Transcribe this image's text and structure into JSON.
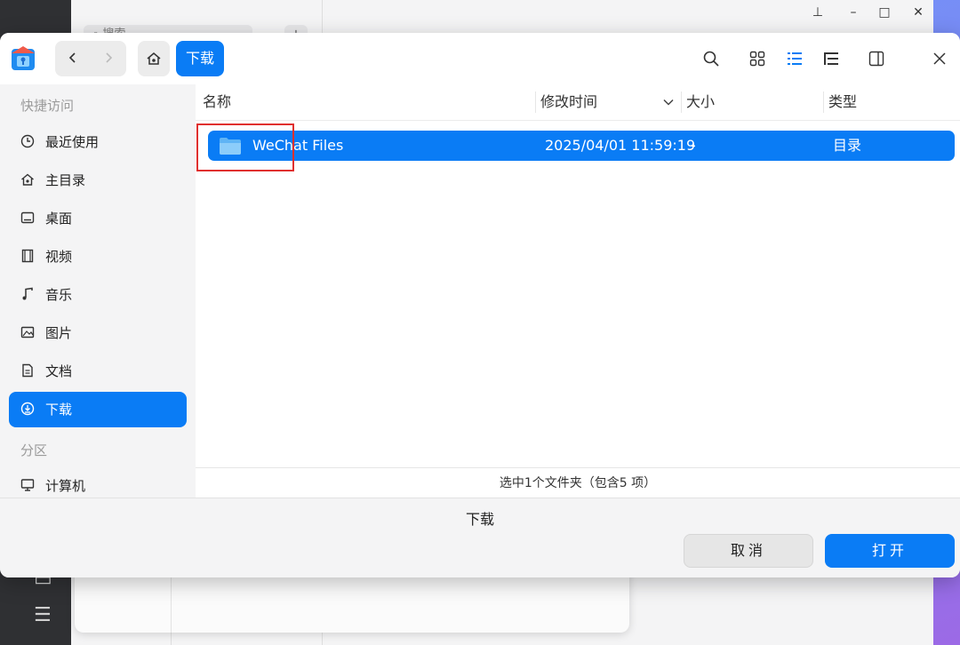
{
  "background": {
    "search_placeholder": "搜索",
    "plus_label": "+",
    "window_controls": [
      "pin-icon",
      "minimize-icon",
      "maximize-icon",
      "close-icon"
    ]
  },
  "toolbar": {
    "back_icon": "chevron-left-icon",
    "forward_icon": "chevron-right-icon",
    "home_icon": "home-icon",
    "breadcrumb": "下载",
    "icons": [
      "search-icon",
      "icon-view-icon",
      "list-view-icon",
      "tree-view-icon",
      "preview-pane-icon",
      "close-icon"
    ]
  },
  "sidebar": {
    "quick_access_label": "快捷访问",
    "items": [
      {
        "label": "最近使用",
        "icon": "clock-icon"
      },
      {
        "label": "主目录",
        "icon": "home-icon"
      },
      {
        "label": "桌面",
        "icon": "desktop-icon"
      },
      {
        "label": "视频",
        "icon": "film-icon"
      },
      {
        "label": "音乐",
        "icon": "music-icon"
      },
      {
        "label": "图片",
        "icon": "image-icon"
      },
      {
        "label": "文档",
        "icon": "document-icon"
      },
      {
        "label": "下载",
        "icon": "download-icon",
        "active": true
      }
    ],
    "partitions_label": "分区",
    "partitions": [
      {
        "label": "计算机",
        "icon": "computer-icon"
      }
    ]
  },
  "list": {
    "columns": [
      "名称",
      "修改时间",
      "大小",
      "类型"
    ],
    "rows": [
      {
        "name": "WeChat Files",
        "modified": "2025/04/01 11:59:19",
        "size": "-",
        "type": "目录",
        "selected": true
      }
    ]
  },
  "status": "选中1个文件夹（包含5 项）",
  "footer": {
    "current_folder": "下载",
    "cancel_label": "取消",
    "open_label": "打开"
  },
  "colors": {
    "accent": "#0a7cf5",
    "highlight": "#e0302f"
  }
}
